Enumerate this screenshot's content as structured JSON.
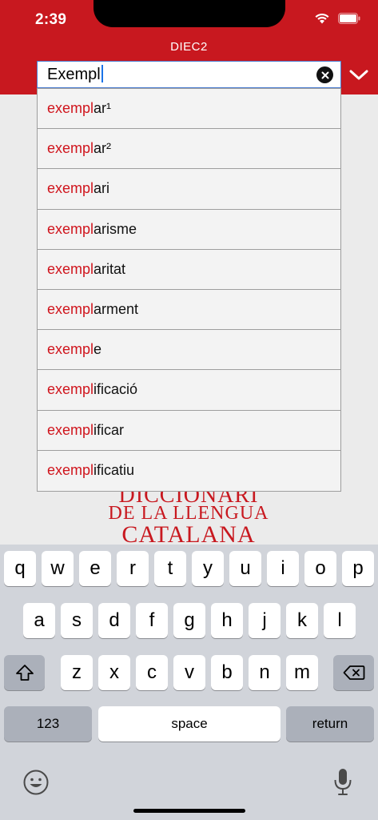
{
  "status_bar": {
    "time": "2:39"
  },
  "app": {
    "title": "DIEC2"
  },
  "search": {
    "query": "Exempl"
  },
  "suggestions": [
    {
      "match": "exempl",
      "rest": "ar¹"
    },
    {
      "match": "exempl",
      "rest": "ar²"
    },
    {
      "match": "exempl",
      "rest": "ari"
    },
    {
      "match": "exempl",
      "rest": "arisme"
    },
    {
      "match": "exempl",
      "rest": "aritat"
    },
    {
      "match": "exempl",
      "rest": "arment"
    },
    {
      "match": "exempl",
      "rest": "e"
    },
    {
      "match": "exempl",
      "rest": "ificació"
    },
    {
      "match": "exempl",
      "rest": "ificar"
    },
    {
      "match": "exempl",
      "rest": "ificatiu"
    }
  ],
  "logo": {
    "line1": "DICCIONARI",
    "line2": "DE LA LLENGUA",
    "line3": "CATALANA"
  },
  "keyboard": {
    "row1": [
      "q",
      "w",
      "e",
      "r",
      "t",
      "y",
      "u",
      "i",
      "o",
      "p"
    ],
    "row2": [
      "a",
      "s",
      "d",
      "f",
      "g",
      "h",
      "j",
      "k",
      "l"
    ],
    "row3": [
      "z",
      "x",
      "c",
      "v",
      "b",
      "n",
      "m"
    ],
    "numbers_label": "123",
    "space_label": "space",
    "return_label": "return"
  },
  "colors": {
    "brand_red": "#c8181f",
    "match_red": "#d0141c",
    "keyboard_bg": "#d1d4da"
  }
}
